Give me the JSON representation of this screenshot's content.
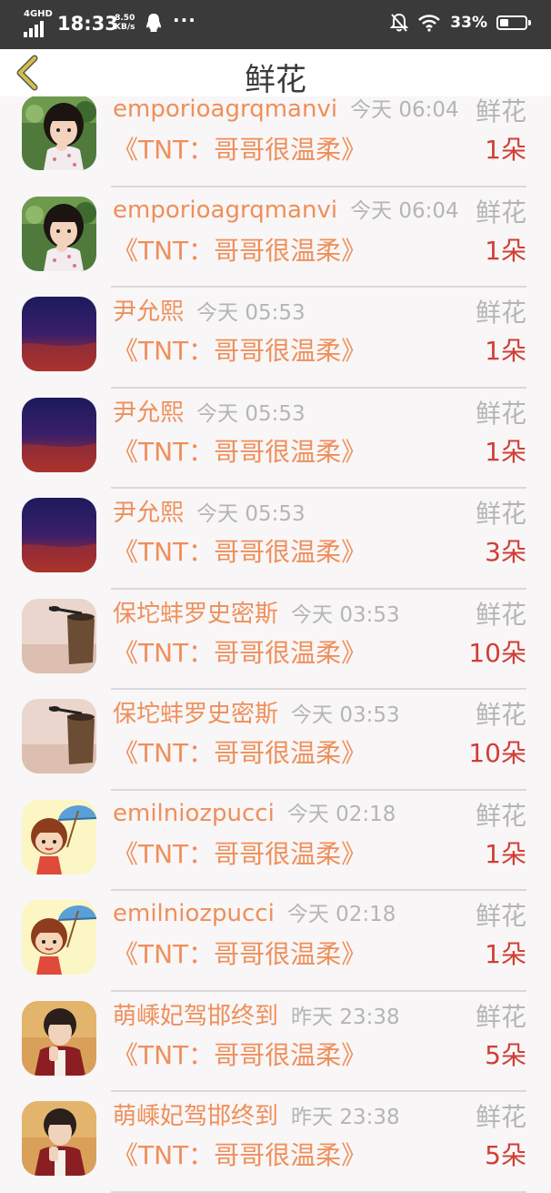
{
  "status_bar": {
    "network": "4GHD",
    "time": "18:33",
    "speed_value": "8.50",
    "speed_unit": "KB/s",
    "more": "···",
    "battery_percent": "33%",
    "battery_level": 0.33
  },
  "header": {
    "title": "鲜花",
    "back_icon": "chevron-left-icon"
  },
  "colors": {
    "name": "#ef8f5a",
    "count": "#d13e35",
    "muted": "#b5b5b5",
    "back_chevron": "#d6bf45"
  },
  "records": [
    {
      "name": "emporioagrqmanvi",
      "time": "今天 06:04",
      "type": "鲜花",
      "title": "《TNT：哥哥很温柔》",
      "count": "1朵",
      "avatar": "girl-photo"
    },
    {
      "name": "emporioagrqmanvi",
      "time": "今天 06:04",
      "type": "鲜花",
      "title": "《TNT：哥哥很温柔》",
      "count": "1朵",
      "avatar": "girl-photo"
    },
    {
      "name": "尹允熙",
      "time": "今天 05:53",
      "type": "鲜花",
      "title": "《TNT：哥哥很温柔》",
      "count": "1朵",
      "avatar": "sunset-sky"
    },
    {
      "name": "尹允熙",
      "time": "今天 05:53",
      "type": "鲜花",
      "title": "《TNT：哥哥很温柔》",
      "count": "1朵",
      "avatar": "sunset-sky"
    },
    {
      "name": "尹允熙",
      "time": "今天 05:53",
      "type": "鲜花",
      "title": "《TNT：哥哥很温柔》",
      "count": "3朵",
      "avatar": "sunset-sky"
    },
    {
      "name": "保坨蚌罗史密斯",
      "time": "今天 03:53",
      "type": "鲜花",
      "title": "《TNT：哥哥很温柔》",
      "count": "10朵",
      "avatar": "cup-photo"
    },
    {
      "name": "保坨蚌罗史密斯",
      "time": "今天 03:53",
      "type": "鲜花",
      "title": "《TNT：哥哥很温柔》",
      "count": "10朵",
      "avatar": "cup-photo"
    },
    {
      "name": "emilniozpucci",
      "time": "今天 02:18",
      "type": "鲜花",
      "title": "《TNT：哥哥很温柔》",
      "count": "1朵",
      "avatar": "umbrella-cartoon"
    },
    {
      "name": "emilniozpucci",
      "time": "今天 02:18",
      "type": "鲜花",
      "title": "《TNT：哥哥很温柔》",
      "count": "1朵",
      "avatar": "umbrella-cartoon"
    },
    {
      "name": "萌嵊妃驾邯终到",
      "time": "昨天 23:38",
      "type": "鲜花",
      "title": "《TNT：哥哥很温柔》",
      "count": "5朵",
      "avatar": "boy-photo"
    },
    {
      "name": "萌嵊妃驾邯终到",
      "time": "昨天 23:38",
      "type": "鲜花",
      "title": "《TNT：哥哥很温柔》",
      "count": "5朵",
      "avatar": "boy-photo"
    }
  ]
}
